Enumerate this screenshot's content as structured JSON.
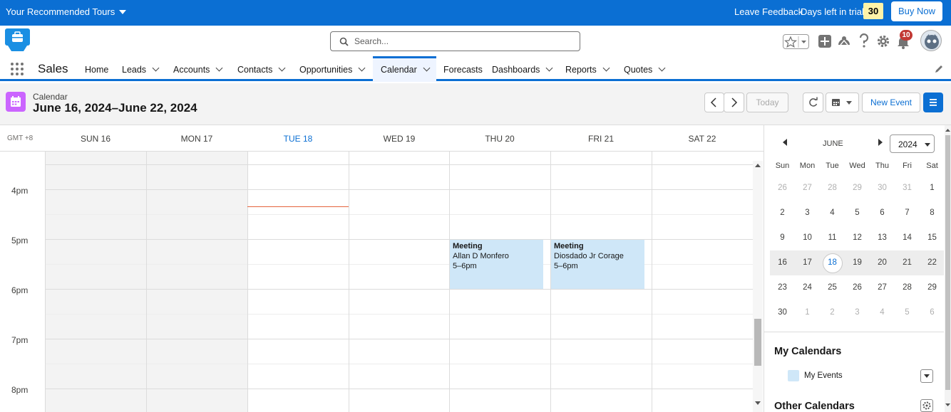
{
  "topbar": {
    "tours_label": "Your Recommended Tours",
    "leave_feedback": "Leave Feedback",
    "days_left_label": "Days left in trial",
    "days_left_value": "30",
    "buy_now": "Buy Now"
  },
  "header": {
    "search_placeholder": "Search...",
    "notification_count": "10"
  },
  "nav": {
    "app_name": "Sales",
    "items": [
      {
        "label": "Home"
      },
      {
        "label": "Leads"
      },
      {
        "label": "Accounts"
      },
      {
        "label": "Contacts"
      },
      {
        "label": "Opportunities"
      },
      {
        "label": "Calendar"
      },
      {
        "label": "Forecasts"
      },
      {
        "label": "Dashboards"
      },
      {
        "label": "Reports"
      },
      {
        "label": "Quotes"
      }
    ]
  },
  "page": {
    "object_label": "Calendar",
    "title": "June 16, 2024–June 22, 2024",
    "today_button": "Today",
    "new_event_button": "New Event"
  },
  "grid": {
    "timezone": "GMT +8",
    "days": [
      "SUN 16",
      "MON 17",
      "TUE 18",
      "WED 19",
      "THU 20",
      "FRI 21",
      "SAT 22"
    ],
    "times": [
      "4pm",
      "5pm",
      "6pm",
      "7pm",
      "8pm"
    ],
    "events": [
      {
        "title": "Meeting",
        "who": "Allan D Monfero",
        "time": "5–6pm"
      },
      {
        "title": "Meeting",
        "who": "Diosdado Jr Corage",
        "time": "5–6pm"
      }
    ]
  },
  "mini_calendar": {
    "month": "JUNE",
    "year": "2024",
    "weekdays": [
      "Sun",
      "Mon",
      "Tue",
      "Wed",
      "Thu",
      "Fri",
      "Sat"
    ],
    "weeks": [
      [
        "26",
        "27",
        "28",
        "29",
        "30",
        "31",
        "1"
      ],
      [
        "2",
        "3",
        "4",
        "5",
        "6",
        "7",
        "8"
      ],
      [
        "9",
        "10",
        "11",
        "12",
        "13",
        "14",
        "15"
      ],
      [
        "16",
        "17",
        "18",
        "19",
        "20",
        "21",
        "22"
      ],
      [
        "23",
        "24",
        "25",
        "26",
        "27",
        "28",
        "29"
      ],
      [
        "30",
        "1",
        "2",
        "3",
        "4",
        "5",
        "6"
      ]
    ]
  },
  "calendars": {
    "my_calendars_heading": "My Calendars",
    "my_events_label": "My Events",
    "other_calendars_heading": "Other Calendars"
  },
  "colors": {
    "brand": "#0b6fd3",
    "event_bg": "#cfe7f8",
    "calendar_icon": "#cb65ff",
    "trial_badge": "#fff3a8"
  }
}
